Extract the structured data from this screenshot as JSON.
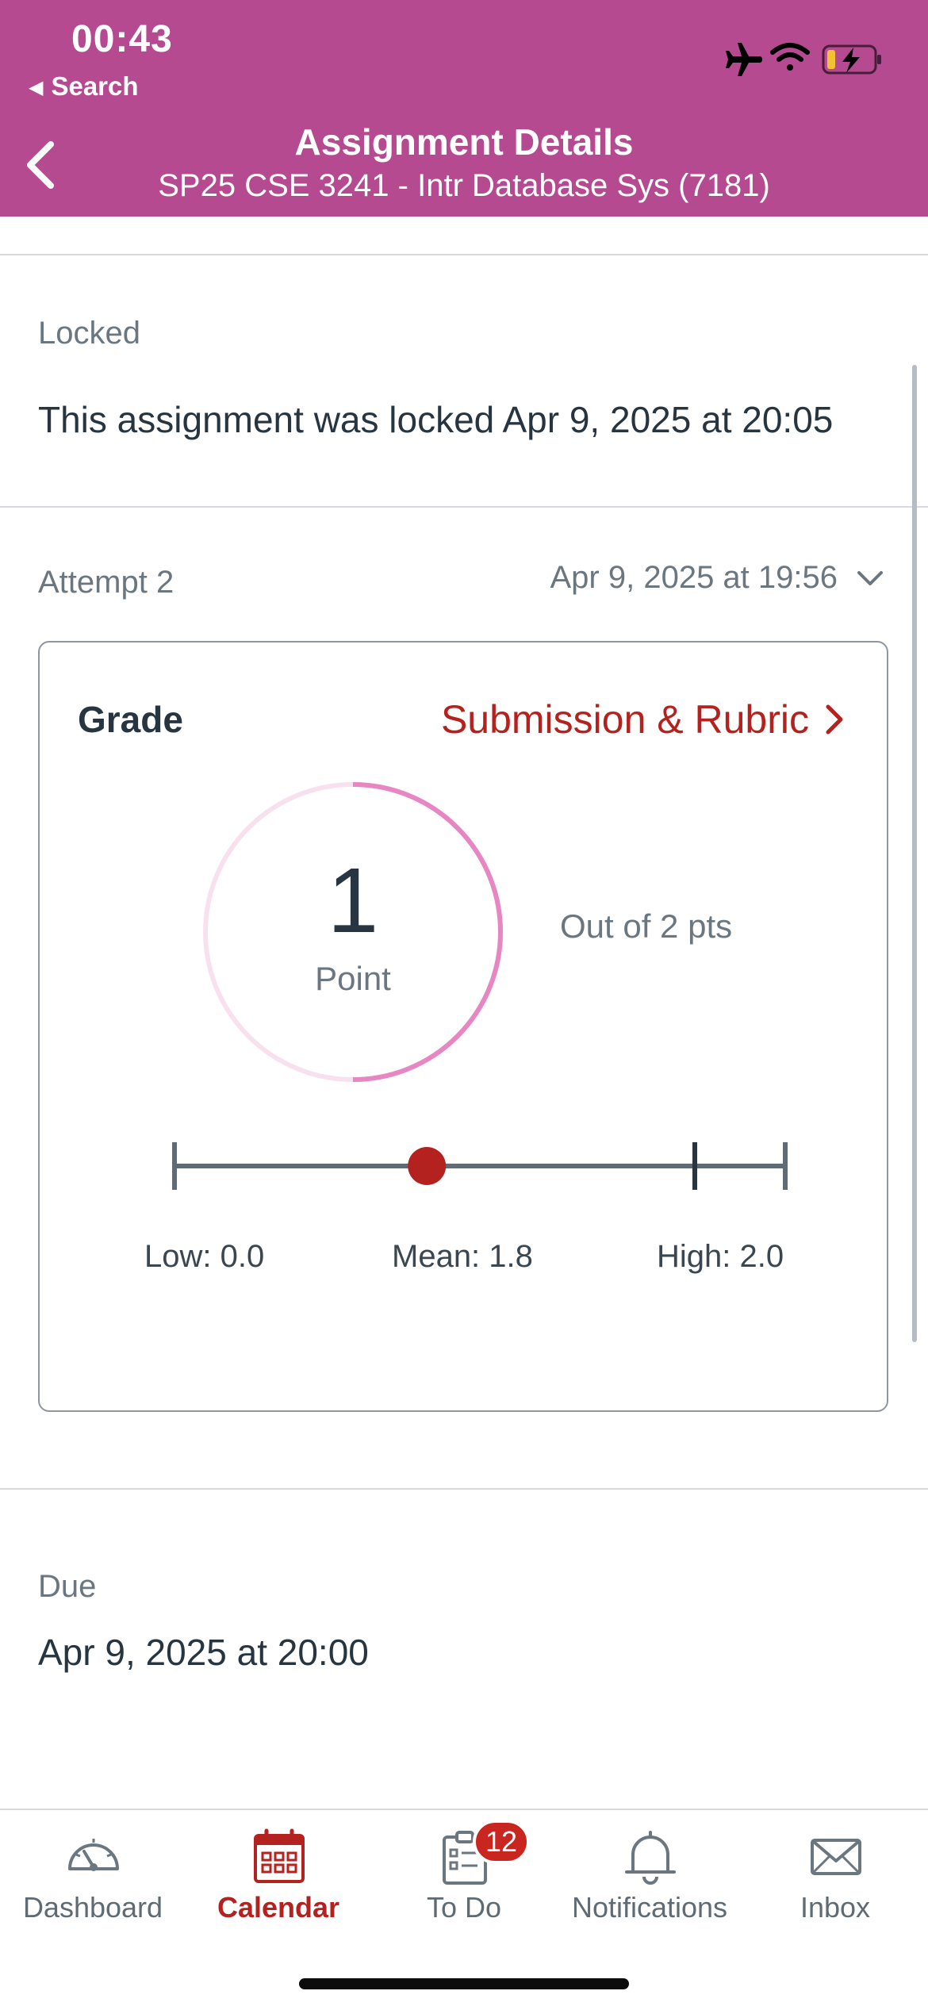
{
  "status_bar": {
    "time": "00:43",
    "back_app": "Search"
  },
  "nav": {
    "title": "Assignment Details",
    "subtitle": "SP25 CSE 3241 - Intr Database Sys (7181)"
  },
  "locked": {
    "label": "Locked",
    "text": "This assignment was locked Apr 9, 2025 at 20:05"
  },
  "attempt": {
    "label": "Attempt 2",
    "date": "Apr 9, 2025 at 19:56"
  },
  "grade": {
    "label": "Grade",
    "link_label": "Submission & Rubric",
    "score": "1",
    "score_unit": "Point",
    "out_of": "Out of 2 pts",
    "score_fraction": 0.5,
    "low_label": "Low: 0.0",
    "mean_label": "Mean: 1.8",
    "high_label": "High: 2.0",
    "low": 0.0,
    "mean": 1.8,
    "high": 2.0,
    "max": 2
  },
  "due": {
    "label": "Due",
    "date": "Apr 9, 2025 at 20:00"
  },
  "tabs": [
    {
      "label": "Dashboard",
      "icon": "dashboard-icon"
    },
    {
      "label": "Calendar",
      "icon": "calendar-icon",
      "active": true
    },
    {
      "label": "To Do",
      "icon": "todo-icon",
      "badge": "12"
    },
    {
      "label": "Notifications",
      "icon": "bell-icon"
    },
    {
      "label": "Inbox",
      "icon": "inbox-icon"
    }
  ],
  "colors": {
    "header": "#b54a90",
    "accent_red": "#b3221e",
    "ring": "#e886c4",
    "ring_track": "#f8e1ef"
  }
}
